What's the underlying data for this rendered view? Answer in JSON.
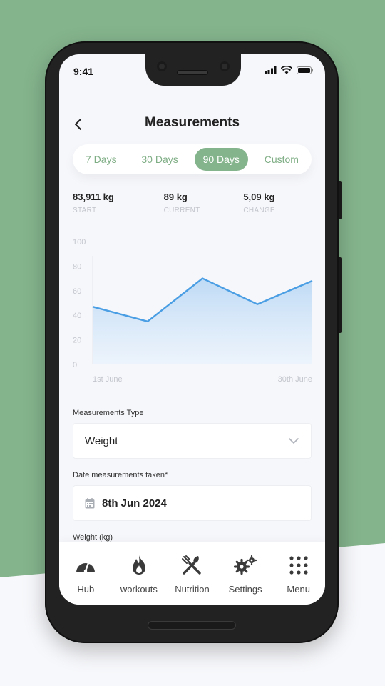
{
  "status": {
    "time": "9:41"
  },
  "header": {
    "title": "Measurements",
    "back_icon": "chevron-left-icon"
  },
  "tabs": [
    {
      "label": "7 Days",
      "active": false
    },
    {
      "label": "30 Days",
      "active": false
    },
    {
      "label": "90 Days",
      "active": true
    },
    {
      "label": "Custom",
      "active": false
    }
  ],
  "stats": [
    {
      "value": "83,911 kg",
      "label": "START"
    },
    {
      "value": "89 kg",
      "label": "CURRENT"
    },
    {
      "value": "5,09 kg",
      "label": "CHANGE"
    }
  ],
  "chart_data": {
    "type": "area",
    "x_labels": [
      "1st June",
      "30th June"
    ],
    "values": [
      47,
      35,
      70,
      49,
      68
    ],
    "ylim": [
      0,
      100
    ],
    "y_ticks": [
      0,
      20,
      40,
      60,
      80,
      100
    ],
    "colors": {
      "line": "#4a9ee3",
      "fill": "#cfe4f7"
    }
  },
  "form": {
    "type_label": "Measurements Type",
    "type_value": "Weight",
    "date_label": "Date measurements taken*",
    "date_value": "8th Jun 2024",
    "weight_label": "Weight (kg)"
  },
  "bottom_nav": [
    {
      "label": "Hub",
      "icon": "gauge-icon"
    },
    {
      "label": "workouts",
      "icon": "flame-icon"
    },
    {
      "label": "Nutrition",
      "icon": "fork-knife-icon"
    },
    {
      "label": "Settings",
      "icon": "gears-icon"
    },
    {
      "label": "Menu",
      "icon": "grid-dots-icon"
    }
  ],
  "colors": {
    "accent": "#84b48c",
    "background": "#84b48c"
  }
}
